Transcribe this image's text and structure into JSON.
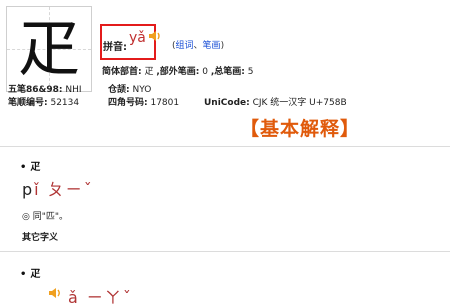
{
  "character": "疋",
  "pinyin": {
    "label": "拼音:",
    "value": "yǎ"
  },
  "links": {
    "open": "(",
    "zuci": "组词",
    "sep": "、",
    "bihua": "笔画",
    "close": ")"
  },
  "row1": {
    "label1": "简体部首:",
    "value1": "疋",
    "label2": ",部外笔画:",
    "value2": "0",
    "label3": ",总笔画:",
    "value3": "5"
  },
  "row2": {
    "wubi_label": "五笔86&98:",
    "wubi_value": "NHI",
    "cangjie_label": "仓颉:",
    "cangjie_value": "NYO"
  },
  "row3": {
    "bishun_label": "笔顺编号:",
    "bishun_value": "52134",
    "sijiao_label": "四角号码:",
    "sijiao_value": "17801",
    "unicode_label": "UniCode:",
    "unicode_value": "CJK 统一汉字 U+758B"
  },
  "section_title": "【基本解释】",
  "entry1": {
    "bullet": "•",
    "head": "疋",
    "zhuyin_p": "p",
    "zhuyin": "ǐ ㄆㄧˇ",
    "definition": "◎ 同\"匹\"。"
  },
  "other_label": "其它字义",
  "entry2": {
    "bullet": "•",
    "head": "疋",
    "zhuyin": "ǎ ㄧㄚˇ"
  },
  "colors": {
    "accent": "#e05a0b",
    "highlight_border": "#e31b1b",
    "link": "#1a4fd6",
    "pinyin": "#c03030"
  }
}
